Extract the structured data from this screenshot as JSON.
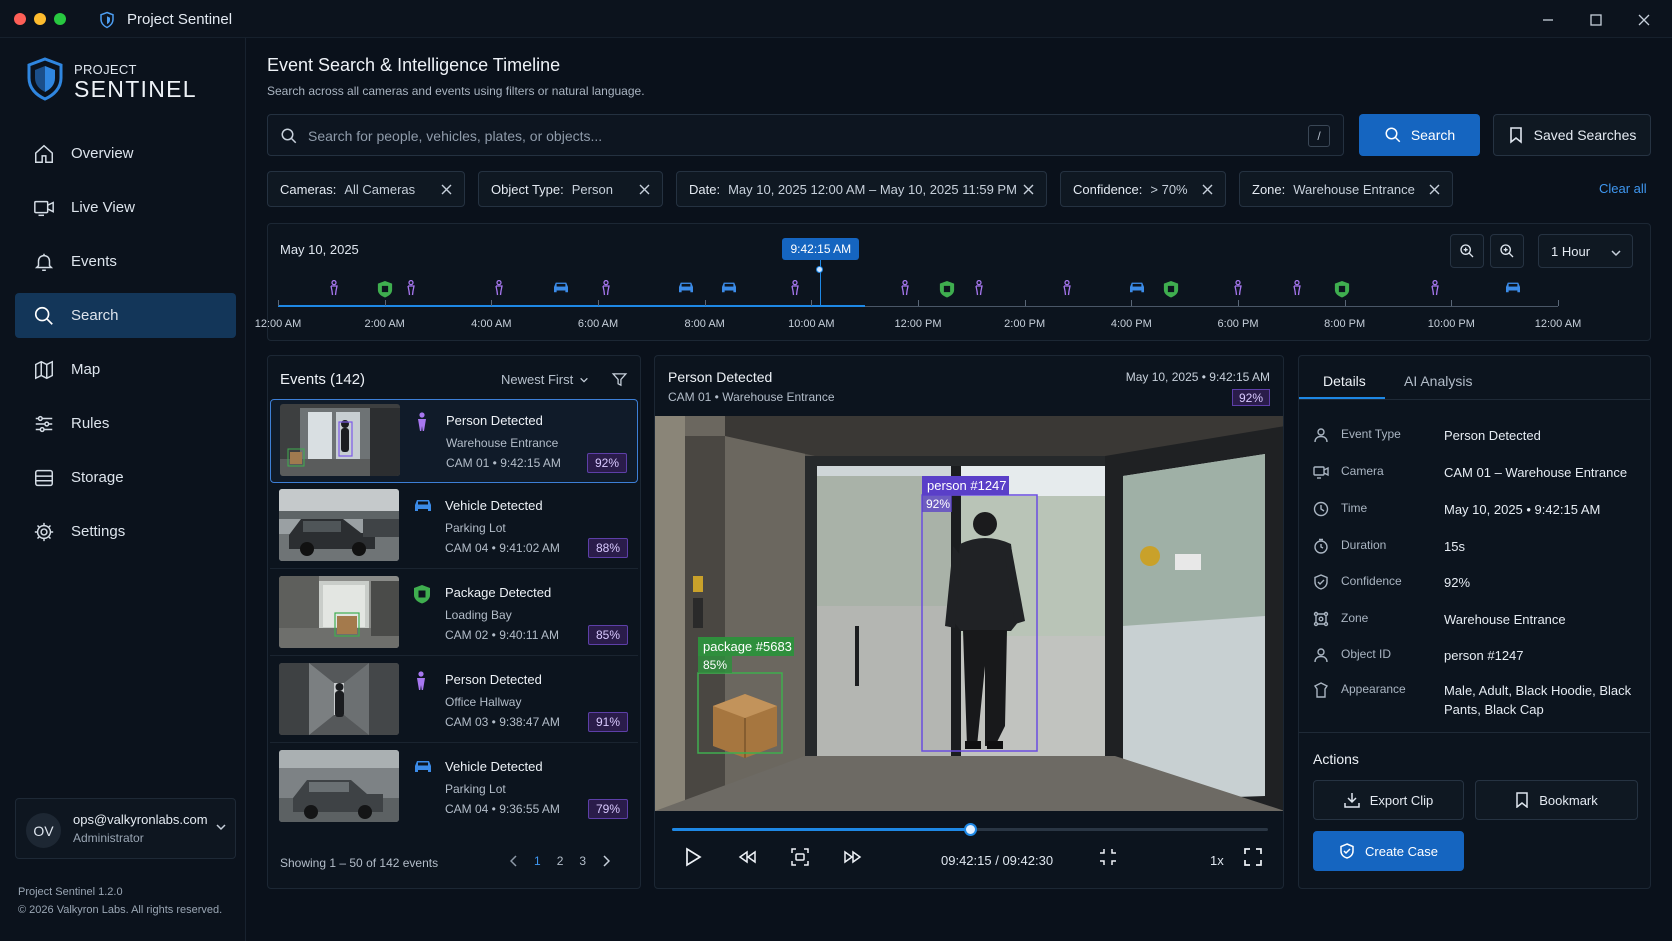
{
  "window": {
    "title": "Project Sentinel"
  },
  "brand": {
    "line1": "PROJECT",
    "line2": "SENTINEL"
  },
  "nav": [
    {
      "label": "Overview",
      "icon": "home-icon"
    },
    {
      "label": "Live View",
      "icon": "camera-icon"
    },
    {
      "label": "Events",
      "icon": "bell-icon"
    },
    {
      "label": "Search",
      "icon": "search-icon",
      "active": true
    },
    {
      "label": "Map",
      "icon": "map-icon"
    },
    {
      "label": "Rules",
      "icon": "sliders-icon"
    },
    {
      "label": "Storage",
      "icon": "storage-icon"
    },
    {
      "label": "Settings",
      "icon": "gear-icon"
    }
  ],
  "user": {
    "initials": "OV",
    "email": "ops@valkyronlabs.com",
    "role": "Administrator"
  },
  "footer": {
    "version": "Project Sentinel 1.2.0",
    "copyright": "© 2026 Valkyron Labs. All rights reserved."
  },
  "header": {
    "title": "Event Search & Intelligence Timeline",
    "subtitle": "Search across all cameras and events using filters or natural language."
  },
  "search": {
    "placeholder": "Search for people, vehicles, plates, or objects...",
    "shortcut": "/",
    "button": "Search",
    "saved": "Saved Searches"
  },
  "filters": [
    {
      "label": "Cameras:",
      "value": "All Cameras"
    },
    {
      "label": "Object Type:",
      "value": "Person"
    },
    {
      "label": "Date:",
      "value": "May 10, 2025 12:00 AM – May 10, 2025 11:59 PM"
    },
    {
      "label": "Confidence:",
      "value": "> 70%"
    },
    {
      "label": "Zone:",
      "value": "Warehouse Entrance"
    }
  ],
  "clear_all": "Clear all",
  "timeline": {
    "date": "May 10, 2025",
    "cursor_time": "9:42:15 AM",
    "cursor_fraction": 0.4237,
    "range": "1 Hour",
    "ticks": [
      "12:00 AM",
      "2:00 AM",
      "4:00 AM",
      "6:00 AM",
      "8:00 AM",
      "10:00 AM",
      "12:00 PM",
      "2:00 PM",
      "4:00 PM",
      "6:00 PM",
      "8:00 PM",
      "10:00 PM",
      "12:00 AM"
    ],
    "events": [
      {
        "hour": 1.05,
        "kind": "person"
      },
      {
        "hour": 2.0,
        "kind": "package"
      },
      {
        "hour": 2.5,
        "kind": "person"
      },
      {
        "hour": 4.15,
        "kind": "person"
      },
      {
        "hour": 5.3,
        "kind": "vehicle"
      },
      {
        "hour": 6.15,
        "kind": "person"
      },
      {
        "hour": 7.65,
        "kind": "vehicle"
      },
      {
        "hour": 8.45,
        "kind": "vehicle"
      },
      {
        "hour": 9.7,
        "kind": "person"
      },
      {
        "hour": 11.75,
        "kind": "person"
      },
      {
        "hour": 12.55,
        "kind": "package"
      },
      {
        "hour": 13.15,
        "kind": "person"
      },
      {
        "hour": 14.8,
        "kind": "person"
      },
      {
        "hour": 16.1,
        "kind": "vehicle"
      },
      {
        "hour": 16.75,
        "kind": "package"
      },
      {
        "hour": 18.0,
        "kind": "person"
      },
      {
        "hour": 19.1,
        "kind": "person"
      },
      {
        "hour": 19.95,
        "kind": "package"
      },
      {
        "hour": 21.7,
        "kind": "person"
      },
      {
        "hour": 23.15,
        "kind": "vehicle"
      }
    ]
  },
  "events": {
    "title": "Events (142)",
    "sort": "Newest First",
    "items": [
      {
        "name": "Person Detected",
        "zone": "Warehouse Entrance",
        "meta": "CAM 01 • 9:42:15 AM",
        "conf": "92%",
        "kind": "person",
        "selected": true
      },
      {
        "name": "Vehicle Detected",
        "zone": "Parking Lot",
        "meta": "CAM 04 • 9:41:02 AM",
        "conf": "88%",
        "kind": "vehicle"
      },
      {
        "name": "Package Detected",
        "zone": "Loading Bay",
        "meta": "CAM 02 • 9:40:11 AM",
        "conf": "85%",
        "kind": "package"
      },
      {
        "name": "Person Detected",
        "zone": "Office Hallway",
        "meta": "CAM 03 • 9:38:47 AM",
        "conf": "91%",
        "kind": "person"
      },
      {
        "name": "Vehicle Detected",
        "zone": "Parking Lot",
        "meta": "CAM 04 • 9:36:55 AM",
        "conf": "79%",
        "kind": "vehicle"
      }
    ],
    "showing": "Showing 1 – 50  of 142 events",
    "pages": [
      "1",
      "2",
      "3"
    ]
  },
  "player": {
    "title": "Person Detected",
    "sub": "CAM 01 • Warehouse Entrance",
    "date": "May 10, 2025 • 9:42:15 AM",
    "conf": "92%",
    "person_label": "person #1247",
    "person_conf": "92%",
    "package_label": "package #5683",
    "package_conf": "85%",
    "progress": 0.5,
    "time": "09:42:15  /  09:42:30",
    "speed": "1x"
  },
  "details": {
    "tabs": [
      "Details",
      "AI Analysis"
    ],
    "rows": [
      {
        "label": "Event Type",
        "value": "Person Detected",
        "icon": "person-icon"
      },
      {
        "label": "Camera",
        "value": "CAM 01 – Warehouse Entrance",
        "icon": "camera-icon"
      },
      {
        "label": "Time",
        "value": "May 10, 2025 • 9:42:15 AM",
        "icon": "clock-icon"
      },
      {
        "label": "Duration",
        "value": "15s",
        "icon": "timer-icon"
      },
      {
        "label": "Confidence",
        "value": "92%",
        "icon": "shield-check-icon"
      },
      {
        "label": "Zone",
        "value": "Warehouse Entrance",
        "icon": "zone-icon"
      },
      {
        "label": "Object ID",
        "value": "person #1247",
        "icon": "id-icon"
      },
      {
        "label": "Appearance",
        "value": "Male, Adult, Black Hoodie, Black Pants, Black Cap",
        "icon": "appearance-icon"
      }
    ],
    "actions_title": "Actions",
    "export": "Export Clip",
    "bookmark": "Bookmark",
    "create_case": "Create Case"
  },
  "colors": {
    "accent": "#1565c0",
    "person": "#a777f0",
    "vehicle": "#3b8be8",
    "package": "#3fae4f"
  }
}
